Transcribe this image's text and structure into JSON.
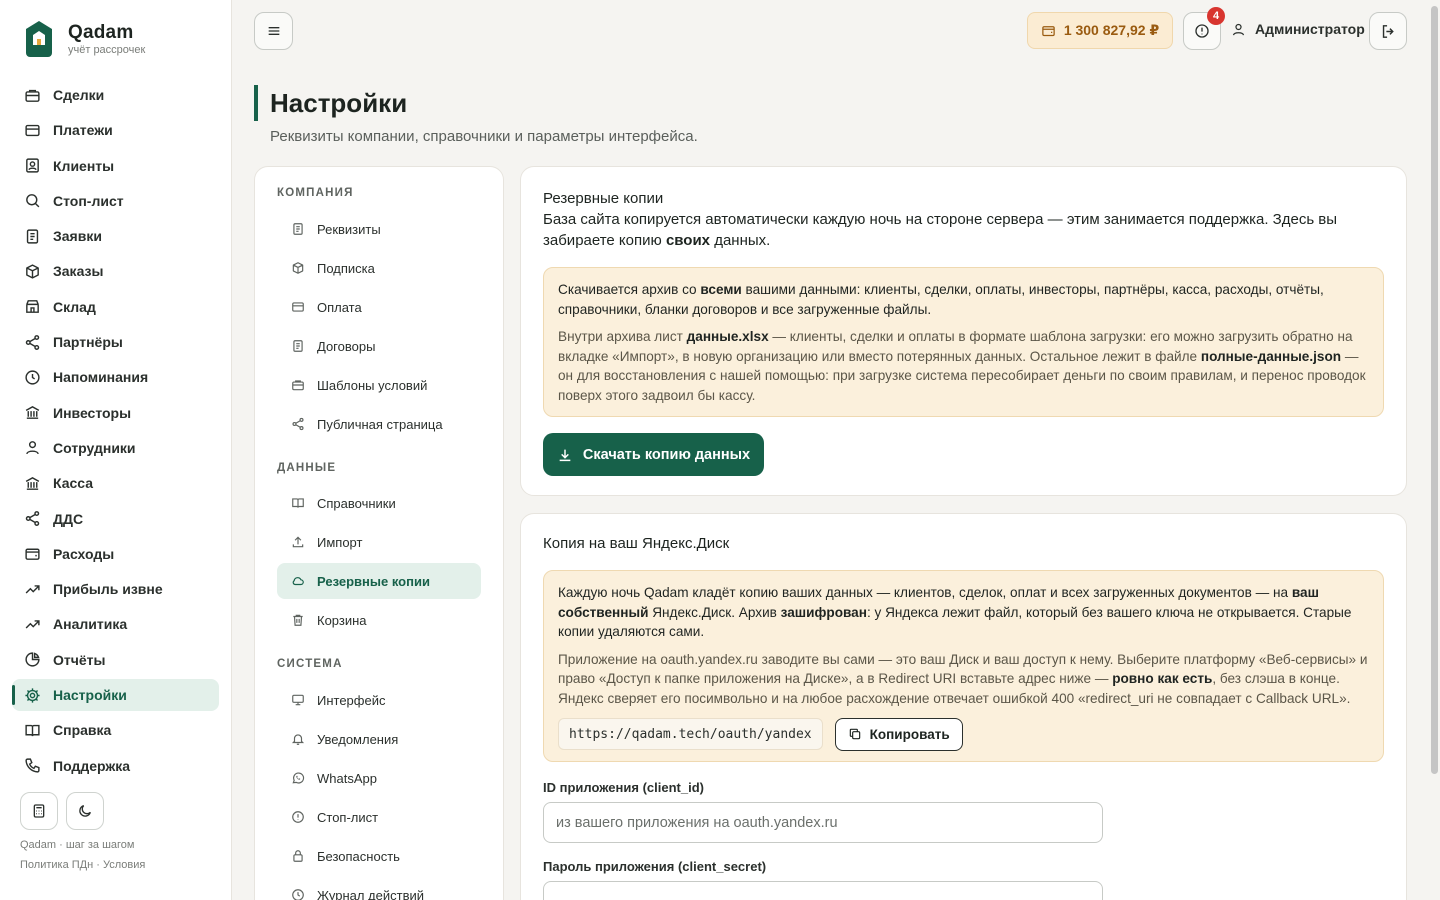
{
  "app": {
    "name": "Qadam",
    "tagline": "учёт рассрочек",
    "colors": {
      "accent": "#17614a",
      "accent_bg": "#e3f0ea",
      "warn_bg": "#fbf0dc",
      "badge": "#d8352f"
    }
  },
  "sidebar": {
    "items": [
      {
        "label": "Сделки",
        "icon": "briefcase-icon"
      },
      {
        "label": "Платежи",
        "icon": "credit-card-icon"
      },
      {
        "label": "Клиенты",
        "icon": "contact-icon"
      },
      {
        "label": "Стоп-лист",
        "icon": "search-icon"
      },
      {
        "label": "Заявки",
        "icon": "document-icon"
      },
      {
        "label": "Заказы",
        "icon": "box-icon"
      },
      {
        "label": "Склад",
        "icon": "store-icon"
      },
      {
        "label": "Партнёры",
        "icon": "share-icon"
      },
      {
        "label": "Напоминания",
        "icon": "clock-icon"
      },
      {
        "label": "Инвесторы",
        "icon": "bank-icon"
      },
      {
        "label": "Сотрудники",
        "icon": "user-icon"
      },
      {
        "label": "Касса",
        "icon": "bank-icon"
      },
      {
        "label": "ДДС",
        "icon": "share-icon"
      },
      {
        "label": "Расходы",
        "icon": "wallet-icon"
      },
      {
        "label": "Прибыль извне",
        "icon": "trend-up-icon"
      },
      {
        "label": "Аналитика",
        "icon": "trend-up-icon"
      },
      {
        "label": "Отчёты",
        "icon": "pie-chart-icon"
      },
      {
        "label": "Настройки",
        "icon": "gear-icon",
        "active": true
      },
      {
        "label": "Справка",
        "icon": "book-icon"
      },
      {
        "label": "Поддержка",
        "icon": "phone-icon"
      }
    ],
    "footer_line1": "Qadam · шаг за шагом",
    "footer_line2": "Политика ПДн · Условия"
  },
  "topbar": {
    "balance": "1 300 827,92 ₽",
    "alerts_count": "4",
    "user_name": "Администратор"
  },
  "page": {
    "title": "Настройки",
    "subtitle": "Реквизиты компании, справочники и параметры интерфейса."
  },
  "settings_nav": {
    "groups": [
      {
        "label": "КОМПАНИЯ",
        "items": [
          {
            "label": "Реквизиты",
            "icon": "document-icon"
          },
          {
            "label": "Подписка",
            "icon": "box-icon"
          },
          {
            "label": "Оплата",
            "icon": "credit-card-icon"
          },
          {
            "label": "Договоры",
            "icon": "document-icon"
          },
          {
            "label": "Шаблоны условий",
            "icon": "briefcase-icon"
          },
          {
            "label": "Публичная страница",
            "icon": "share-icon"
          }
        ]
      },
      {
        "label": "ДАННЫЕ",
        "items": [
          {
            "label": "Справочники",
            "icon": "book-icon"
          },
          {
            "label": "Импорт",
            "icon": "upload-icon"
          },
          {
            "label": "Резервные копии",
            "icon": "cloud-icon",
            "active": true
          },
          {
            "label": "Корзина",
            "icon": "trash-icon"
          }
        ]
      },
      {
        "label": "СИСТЕМА",
        "items": [
          {
            "label": "Интерфейс",
            "icon": "monitor-icon"
          },
          {
            "label": "Уведомления",
            "icon": "bell-icon"
          },
          {
            "label": "WhatsApp",
            "icon": "whatsapp-icon"
          },
          {
            "label": "Стоп-лист",
            "icon": "alert-circle-icon"
          },
          {
            "label": "Безопасность",
            "icon": "lock-icon"
          },
          {
            "label": "Журнал действий",
            "icon": "clock-icon"
          }
        ]
      }
    ]
  },
  "backup": {
    "title": "Резервные копии",
    "desc_1": "База сайта копируется автоматически каждую ночь на стороне сервера — этим занимается поддержка. Здесь вы забираете копию ",
    "desc_bold": "своих",
    "desc_2": " данных.",
    "note_main_1": "Скачивается архив со ",
    "note_main_bold": "всеми",
    "note_main_2": " вашими данными: клиенты, сделки, оплаты, инвесторы, партнёры, касса, расходы, отчёты, справочники, бланки договоров и все загруженные файлы.",
    "note_sub_1": "Внутри архива лист ",
    "note_sub_bold1": "данные.xlsx",
    "note_sub_2": " — клиенты, сделки и оплаты в формате шаблона загрузки: его можно загрузить обратно на вкладке «Импорт», в новую организацию или вместо потерянных данных. Остальное лежит в файле ",
    "note_sub_bold2": "полные-данные.json",
    "note_sub_3": " — он для восстановления с нашей помощью: при загрузке система пересобирает деньги по своим правилам, и перенос проводок поверх этого задвоил бы кассу.",
    "download_label": "Скачать копию данных"
  },
  "yadisk": {
    "title": "Копия на ваш Яндекс.Диск",
    "note_main_1": "Каждую ночь Qadam кладёт копию ваших данных — клиентов, сделок, оплат и всех загруженных документов — на ",
    "note_main_bold1": "ваш собственный",
    "note_main_2": " Яндекс.Диск. Архив ",
    "note_main_bold2": "зашифрован",
    "note_main_3": ": у Яндекса лежит файл, который без вашего ключа не открывается. Старые копии удаляются сами.",
    "note_sub_1": "Приложение на oauth.yandex.ru заводите вы сами — это ваш Диск и ваш доступ к нему. Выберите платформу «Веб-сервисы» и право «Доступ к папке приложения на Диске», а в Redirect URI вставьте адрес ниже — ",
    "note_sub_bold": "ровно как есть",
    "note_sub_2": ", без слэша в конце. Яндекс сверяет его посимвольно и на любое расхождение отвечает ошибкой 400 «redirect_uri не совпадает с Callback URL».",
    "redirect_uri": "https://qadam.tech/oauth/yandex",
    "copy_label": "Копировать",
    "client_id_label": "ID приложения (client_id)",
    "client_id_placeholder": "из вашего приложения на oauth.yandex.ru",
    "client_secret_label": "Пароль приложения (client_secret)",
    "client_secret_placeholder": ""
  }
}
